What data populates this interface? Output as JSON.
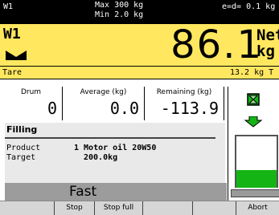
{
  "infobar": {
    "scale_id": "W1",
    "max_capacity": "Max 300 kg",
    "min_capacity": "Min 2.0 kg",
    "division": "e=d= 0.1 kg"
  },
  "weight": {
    "scale_id": "W1",
    "value": "86.1",
    "mode": "Net",
    "unit": "kg",
    "stability_icon": "stable-icon"
  },
  "tare": {
    "label": "Tare",
    "value": "13.2 kg T"
  },
  "values": [
    {
      "label": "Drum",
      "value": "0"
    },
    {
      "label": "Average (kg)",
      "value": "0.0"
    },
    {
      "label": "Remaining (kg)",
      "value": "-113.9"
    }
  ],
  "filling": {
    "title": "Filling",
    "product_label": "Product",
    "product_value": "1 Motor oil 20W50",
    "target_label": "Target",
    "target_value": "200.0kg"
  },
  "speed": {
    "label": "Fast"
  },
  "graphic": {
    "fill_level": 0.35,
    "fill_color": "#15b415",
    "icons": [
      "valve-icon",
      "arrow-down-icon"
    ]
  },
  "softkeys": [
    "",
    "Stop",
    "Stop full",
    "",
    "",
    "Abort"
  ],
  "colors": {
    "display_yellow": "#ffe75f",
    "fill_green": "#15b415",
    "speed_gray": "#9c9c9c"
  }
}
